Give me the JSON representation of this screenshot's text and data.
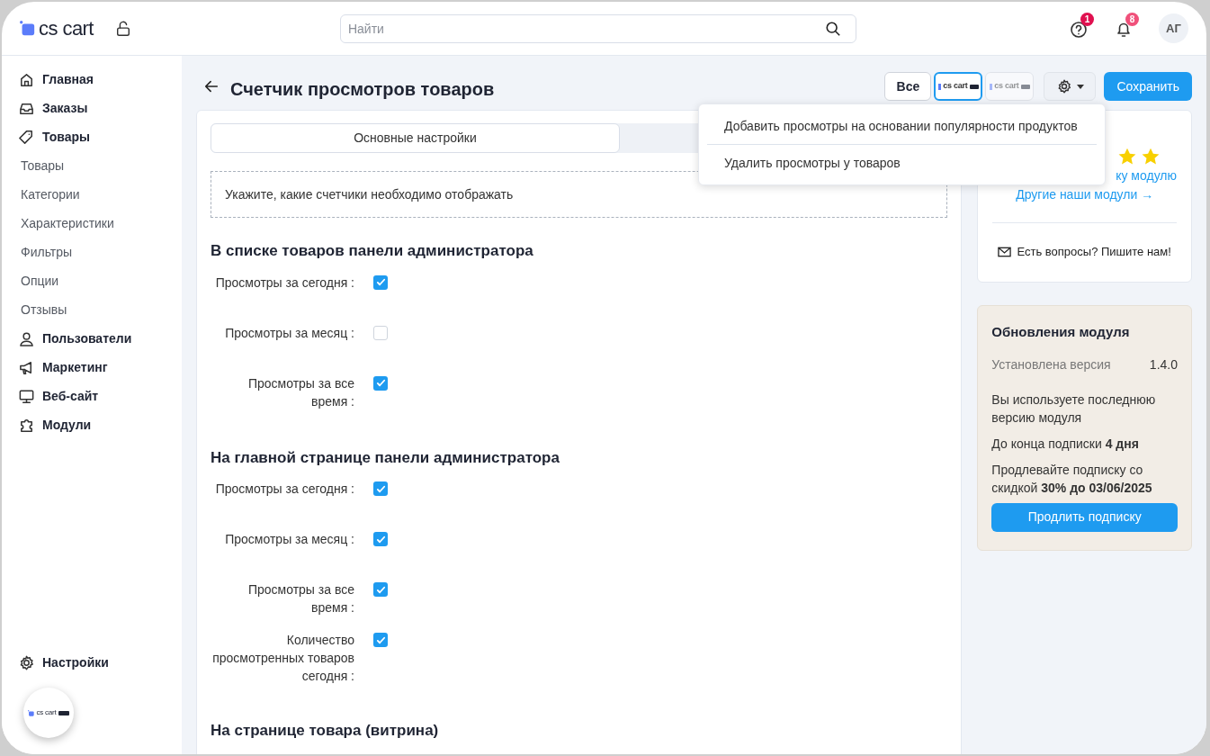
{
  "header": {
    "logo": "cs cart",
    "search": {
      "placeholder": "Найти"
    },
    "help_badge": "1",
    "notifications_badge": "8",
    "avatar": "АГ"
  },
  "sidebar": {
    "items": [
      {
        "kind": "main",
        "label": "Главная"
      },
      {
        "kind": "main",
        "label": "Заказы"
      },
      {
        "kind": "main",
        "label": "Товары"
      },
      {
        "kind": "sub",
        "label": "Товары"
      },
      {
        "kind": "sub",
        "label": "Категории"
      },
      {
        "kind": "sub",
        "label": "Характеристики"
      },
      {
        "kind": "sub",
        "label": "Фильтры"
      },
      {
        "kind": "sub",
        "label": "Опции"
      },
      {
        "kind": "sub",
        "label": "Отзывы"
      },
      {
        "kind": "main",
        "label": "Пользователи"
      },
      {
        "kind": "main",
        "label": "Маркетинг"
      },
      {
        "kind": "main",
        "label": "Веб-сайт"
      },
      {
        "kind": "main",
        "label": "Модули"
      }
    ],
    "settings": "Настройки",
    "footer_logo": "cs cart"
  },
  "page": {
    "title": "Счетчик просмотров товаров",
    "storefronts": [
      {
        "kind": "text",
        "label": "Все",
        "selected": false
      },
      {
        "kind": "logo",
        "label": "cs cart",
        "selected": true
      },
      {
        "kind": "logo",
        "label": "cs cart",
        "selected": false
      }
    ],
    "save_button": "Сохранить",
    "menu": [
      "Добавить просмотры на основании популярности продуктов",
      "Удалить просмотры у товаров"
    ]
  },
  "tabs": [
    {
      "label": "Основные настройки",
      "selected": true
    }
  ],
  "notice": "Укажите, какие счетчики необходимо отображать",
  "sections": [
    {
      "title": "В списке товаров панели администратора",
      "fields": [
        {
          "label": "Просмотры за сегодня :",
          "checked": true
        },
        {
          "label": "Просмотры за месяц :",
          "checked": false
        },
        {
          "label": "Просмотры за все время :",
          "checked": true
        }
      ]
    },
    {
      "title": "На главной странице панели администратора",
      "fields": [
        {
          "label": "Просмотры за сегодня :",
          "checked": true
        },
        {
          "label": "Просмотры за месяц :",
          "checked": true
        },
        {
          "label": "Просмотры за все время :",
          "checked": true
        },
        {
          "label": "Количество просмотренных товаров сегодня :",
          "checked": true
        }
      ]
    },
    {
      "title": "На странице товара (витрина)"
    }
  ],
  "info_card": {
    "link_partial": "ку модулю",
    "link": "Другие наши модули →",
    "contact": "Есть вопросы? Пишите нам!"
  },
  "updates": {
    "title": "Обновления модуля",
    "version_label": "Установлена версия",
    "version": "1.4.0",
    "status": "Вы используете последнюю версию модуля",
    "days_left": "До конца подписки **4 дня**",
    "offer": "Продлевайте подписку со скидкой **30% до 03/06/2025**",
    "button": "Продлить подписку"
  }
}
